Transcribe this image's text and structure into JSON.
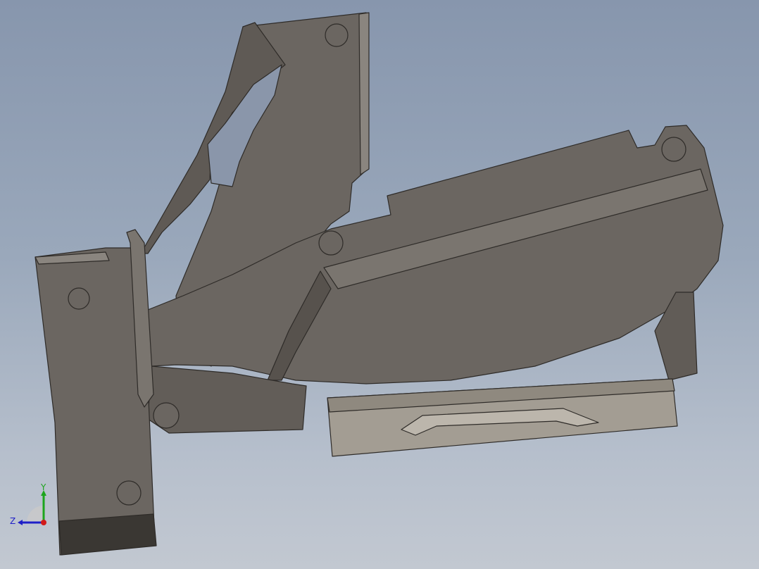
{
  "viewport": {
    "background_top": "#8796ad",
    "background_bottom": "#c2c8d1"
  },
  "model": {
    "face_color": "#6b6661",
    "edge_color": "#2e2b28",
    "highlight_color": "#8a857f",
    "shadow_color": "#3a3733",
    "plate_color": "#a39d93"
  },
  "triad": {
    "x_label": "",
    "y_label": "Y",
    "z_label": "Z",
    "x_color": "#d11a1a",
    "y_color": "#1da51d",
    "z_color": "#1f1fc8"
  }
}
